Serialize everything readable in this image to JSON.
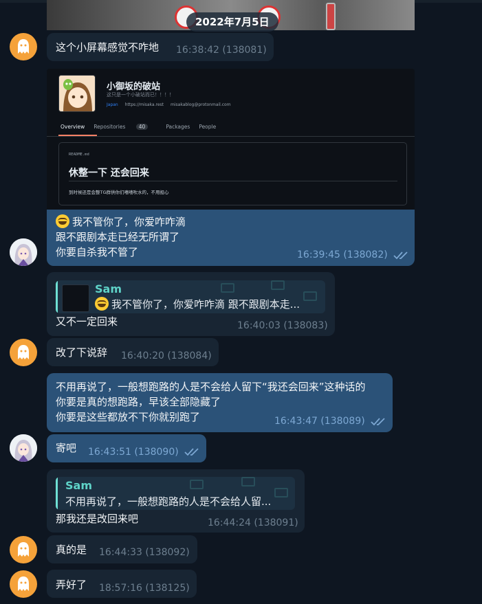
{
  "date_pill": "2022年7月5日",
  "screenshot": {
    "name": "小御坂的破站",
    "bio": "这只是一个小破站而已！！！！",
    "location": "Japan",
    "website": "https://misaka.rest",
    "email": "misakablog@protonmail.com",
    "tabs": [
      "Overview",
      "Repositories",
      "Packages",
      "People"
    ],
    "repo_count": "40",
    "readme_file": "README.md",
    "readme_title": "休整一下 还会回来",
    "readme_text": "到时候还是会整TG群供你们嘻嘻吹水的，不用担心"
  },
  "messages": [
    {
      "text": "这个小屏幕感觉不咋地",
      "meta": "16:38:42 (138081)"
    },
    {
      "lines": [
        "我不管你了，你爱咋咋滴",
        "跟不跟剧本走已经无所谓了",
        "你要自杀我不管了"
      ],
      "meta": "16:39:45 (138082)"
    },
    {
      "reply_sender": "Sam",
      "reply_text": "我不管你了，你爱咋咋滴 跟不跟剧本走...",
      "text": "又不一定回来",
      "meta": "16:40:03 (138083)"
    },
    {
      "text": "改了下说辞",
      "meta": "16:40:20 (138084)"
    },
    {
      "lines": [
        "不用再说了，一般想跑路的人是不会给人留下“我还会回来”这种话的",
        "你要是真的想跑路，早该全部隐藏了",
        "你要是这些都放不下你就别跑了"
      ],
      "meta": "16:43:47 (138089)"
    },
    {
      "text": "寄吧",
      "meta": "16:43:51 (138090)"
    },
    {
      "reply_sender": "Sam",
      "reply_text": "不用再说了，一般想跑路的人是不会给人留...",
      "text": "那我还是改回来吧",
      "meta": "16:44:24 (138091)"
    },
    {
      "text": "真的是",
      "meta": "16:44:33 (138092)"
    },
    {
      "text": "弄好了",
      "meta": "18:57:16 (138125)"
    }
  ],
  "colors": {
    "background": "#0e1621",
    "incoming": "#182533",
    "outgoing": "#2b5278",
    "accent": "#5fd3c8",
    "ghost_avatar": "#f5a23a"
  }
}
